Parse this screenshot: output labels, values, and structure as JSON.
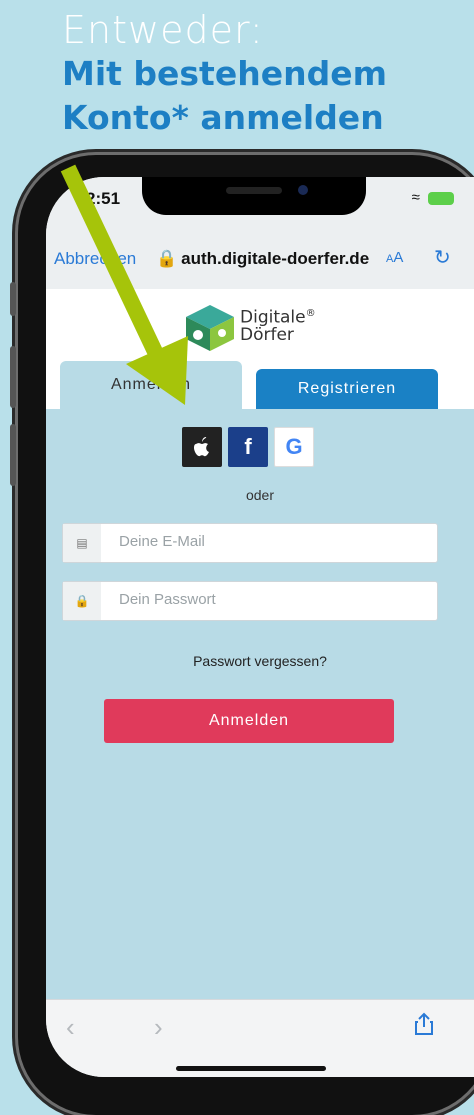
{
  "headline": {
    "line1": "Entweder:",
    "line2": "Mit bestehendem",
    "line3": "Konto* anmelden"
  },
  "status": {
    "time": "2:51"
  },
  "browser": {
    "cancel": "Abbrechen",
    "url": "auth.digitale-doerfer.de",
    "aa_small": "A",
    "aa_large": "A"
  },
  "logo": {
    "line1": "Digitale",
    "line2": "Dörfer",
    "reg": "®"
  },
  "tabs": {
    "login": "Anmelden",
    "register": "Registrieren"
  },
  "social": {
    "apple_icon": "apple-icon",
    "facebook_label": "f",
    "google_label": "G"
  },
  "form": {
    "or": "oder",
    "email_placeholder": "Deine E-Mail",
    "password_placeholder": "Dein Passwort",
    "forgot": "Passwort vergessen?",
    "submit": "Anmelden"
  },
  "toolbar": {
    "back": "‹",
    "forward": "›"
  },
  "colors": {
    "accent": "#1a81c5",
    "submit": "#e03a5b",
    "arrow": "#a6c40a"
  }
}
